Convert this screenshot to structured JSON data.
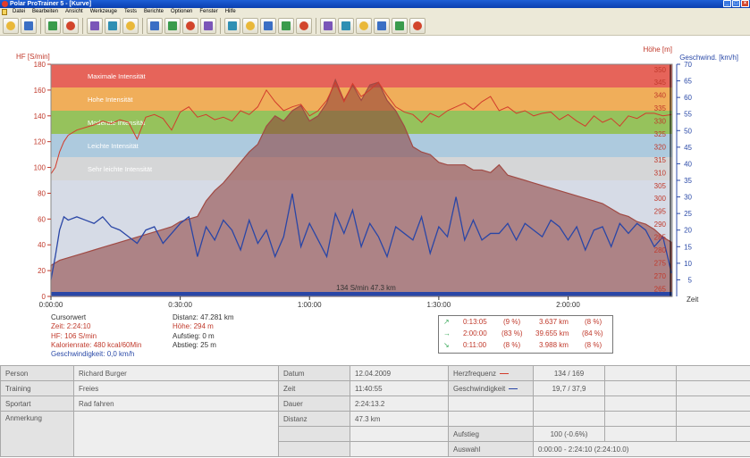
{
  "window": {
    "title": "Polar ProTrainer 5 - [Kurve]"
  },
  "menu": [
    "Datei",
    "Bearbeiten",
    "Ansicht",
    "Werkzeuge",
    "Tests",
    "Berichte",
    "Optionen",
    "Fenster",
    "Hilfe"
  ],
  "toolbar": {
    "icons": [
      "open-folder-icon",
      "save-icon",
      "refresh-icon",
      "settings-icon",
      "list-icon",
      "calendar-icon",
      "export-icon",
      "chart-bar-icon",
      "chart-column-icon",
      "zones-icon",
      "laps-icon",
      "zoom-icon",
      "download-icon",
      "upload-icon",
      "sync-icon",
      "compare-icon",
      "report-hr-icon",
      "report-zones-icon",
      "report-week-icon",
      "report-month-icon",
      "report-year-icon",
      "user-icon"
    ]
  },
  "chart_data": {
    "type": "line",
    "title": "",
    "xlabel": "Zeit",
    "y_left_label": "HF [S/min]",
    "y_right1_label": "Höhe [m]",
    "y_right2_label": "Geschwind. [km/h]",
    "x_ticks": [
      "0:00:00",
      "0:30:00",
      "1:00:00",
      "1:30:00",
      "2:00:00"
    ],
    "x_range_min": [
      0,
      144.17
    ],
    "y_left_ticks": [
      0,
      20,
      40,
      60,
      80,
      100,
      120,
      140,
      160,
      180
    ],
    "y_right1_ticks": [
      265,
      270,
      275,
      280,
      285,
      290,
      295,
      300,
      305,
      310,
      315,
      320,
      325,
      330,
      335,
      340,
      345,
      350
    ],
    "y_right2_ticks": [
      5,
      10,
      15,
      20,
      25,
      30,
      35,
      40,
      45,
      50,
      55,
      60,
      65,
      70
    ],
    "zones": [
      {
        "name": "Maximale Intensität",
        "from": 162,
        "to": 180,
        "color": "#e8574a"
      },
      {
        "name": "Hohe Intensität",
        "from": 144,
        "to": 162,
        "color": "#f3a84a"
      },
      {
        "name": "Moderate Intensität",
        "from": 126,
        "to": 144,
        "color": "#8fbf4c"
      },
      {
        "name": "Leichte Intensität",
        "from": 108,
        "to": 126,
        "color": "#a8c8dd"
      },
      {
        "name": "Sehr leichte Intensität",
        "from": 90,
        "to": 108,
        "color": "#d5d5d5"
      }
    ],
    "series": [
      {
        "name": "Herzfrequenz",
        "axis": "left",
        "color": "#d23c2c",
        "x": [
          0,
          1,
          2,
          3,
          4,
          6,
          8,
          10,
          12,
          14,
          16,
          18,
          20,
          22,
          24,
          26,
          28,
          30,
          32,
          34,
          36,
          38,
          40,
          42,
          44,
          46,
          48,
          50,
          52,
          54,
          56,
          58,
          60,
          62,
          64,
          66,
          68,
          70,
          72,
          74,
          76,
          78,
          80,
          82,
          84,
          86,
          88,
          90,
          92,
          94,
          96,
          98,
          100,
          102,
          104,
          106,
          108,
          110,
          112,
          114,
          116,
          118,
          120,
          122,
          124,
          126,
          128,
          130,
          132,
          134,
          136,
          138,
          140,
          142,
          144
        ],
        "values": [
          95,
          100,
          112,
          120,
          125,
          129,
          131,
          133,
          136,
          134,
          137,
          135,
          122,
          139,
          141,
          138,
          129,
          143,
          147,
          139,
          141,
          137,
          139,
          136,
          144,
          141,
          147,
          160,
          151,
          144,
          147,
          149,
          140,
          144,
          152,
          166,
          151,
          165,
          155,
          160,
          166,
          156,
          147,
          143,
          141,
          135,
          142,
          139,
          144,
          147,
          150,
          145,
          151,
          155,
          144,
          147,
          142,
          144,
          140,
          142,
          143,
          137,
          141,
          136,
          132,
          140,
          135,
          138,
          132,
          140,
          138,
          142,
          142,
          140,
          141
        ]
      },
      {
        "name": "Höhe",
        "axis": "right1",
        "color": "#a04a44",
        "x": [
          0,
          2,
          4,
          6,
          8,
          10,
          12,
          14,
          16,
          18,
          20,
          22,
          24,
          26,
          28,
          30,
          32,
          34,
          36,
          38,
          40,
          42,
          44,
          46,
          48,
          50,
          52,
          54,
          56,
          58,
          60,
          62,
          64,
          66,
          68,
          70,
          72,
          74,
          76,
          78,
          80,
          82,
          84,
          86,
          88,
          90,
          92,
          94,
          96,
          98,
          100,
          102,
          104,
          106,
          108,
          110,
          112,
          114,
          116,
          118,
          120,
          122,
          124,
          126,
          128,
          130,
          132,
          134,
          136,
          138,
          140,
          142,
          144
        ],
        "values": [
          274,
          276,
          277,
          278,
          279,
          280,
          281,
          282,
          283,
          284,
          285,
          286,
          287,
          288,
          289,
          291,
          292,
          293,
          299,
          303,
          306,
          310,
          314,
          318,
          321,
          328,
          332,
          330,
          334,
          336,
          330,
          332,
          337,
          346,
          338,
          344,
          338,
          344,
          345,
          338,
          334,
          328,
          320,
          318,
          317,
          314,
          313,
          313,
          313,
          311,
          311,
          310,
          313,
          309,
          308,
          307,
          306,
          305,
          304,
          303,
          302,
          301,
          300,
          299,
          298,
          296,
          294,
          293,
          291,
          290,
          288,
          285,
          283
        ]
      },
      {
        "name": "Geschwindigkeit",
        "axis": "right2",
        "color": "#2a46a6",
        "x": [
          0,
          1,
          2,
          3,
          4,
          6,
          8,
          10,
          12,
          14,
          16,
          18,
          20,
          22,
          24,
          26,
          28,
          30,
          32,
          34,
          36,
          38,
          40,
          42,
          44,
          46,
          48,
          50,
          52,
          54,
          56,
          58,
          60,
          62,
          64,
          66,
          68,
          70,
          72,
          74,
          76,
          78,
          80,
          82,
          84,
          86,
          88,
          90,
          92,
          94,
          96,
          98,
          100,
          102,
          104,
          106,
          108,
          110,
          112,
          114,
          116,
          118,
          120,
          122,
          124,
          126,
          128,
          130,
          132,
          134,
          136,
          138,
          140,
          142,
          144
        ],
        "values": [
          5,
          12,
          20,
          24,
          23,
          24,
          23,
          22,
          24,
          21,
          20,
          18,
          16,
          20,
          21,
          16,
          19,
          22,
          24,
          12,
          21,
          17,
          23,
          20,
          14,
          23,
          16,
          20,
          12,
          18,
          31,
          15,
          22,
          17,
          12,
          25,
          19,
          26,
          15,
          22,
          18,
          12,
          21,
          19,
          17,
          24,
          13,
          21,
          18,
          30,
          17,
          23,
          17,
          19,
          19,
          22,
          17,
          22,
          20,
          18,
          23,
          21,
          17,
          21,
          14,
          20,
          21,
          15,
          22,
          19,
          22,
          20,
          15,
          18,
          7
        ]
      }
    ],
    "cursor_label": "134 S/min 47.3 km"
  },
  "info_left": {
    "cursor": "Cursorwert",
    "time": "Zeit: 2:24:10",
    "hf": "HF: 106 S/min",
    "kcal": "Kalorienrate: 480 kcal/60Min",
    "speed": "Geschwindigkeit: 0,0 km/h"
  },
  "info_mid": {
    "distance": "Distanz: 47.281 km",
    "altitude": "Höhe: 294 m",
    "ascent": "Aufstieg: 0 m",
    "descent": "Abstieg: 25 m"
  },
  "stats": [
    {
      "arrow": "↗",
      "time": "0:13:05",
      "pct_time": "(9 %)",
      "dist": "3.637 km",
      "pct_dist": "(8 %)"
    },
    {
      "arrow": "→",
      "time": "2:00:00",
      "pct_time": "(83 %)",
      "dist": "39.655 km",
      "pct_dist": "(84 %)"
    },
    {
      "arrow": "↘",
      "time": "0:11:00",
      "pct_time": "(8 %)",
      "dist": "3.988 km",
      "pct_dist": "(8 %)"
    }
  ],
  "table": {
    "person_label": "Person",
    "person": "Richard Burger",
    "training_label": "Training",
    "training": "Freies",
    "sport_label": "Sportart",
    "sport": "Rad fahren",
    "note_label": "Anmerkung",
    "date_label": "Datum",
    "date": "12.04.2009",
    "time_label": "Zeit",
    "time": "11:40:55",
    "duration_label": "Dauer",
    "duration": "2:24:13.2",
    "distance_label": "Distanz",
    "distance": "47.3 km",
    "hr_label": "Herzfrequenz",
    "hr": "134 / 169",
    "speed_label": "Geschwindigkeit",
    "speed": "19,7 / 37,9",
    "ascent_label": "Aufstieg",
    "ascent": "100 (-0.6%)",
    "selection_label": "Auswahl",
    "selection": "0:00:00 - 2:24:10 (2:24:10.0)"
  }
}
